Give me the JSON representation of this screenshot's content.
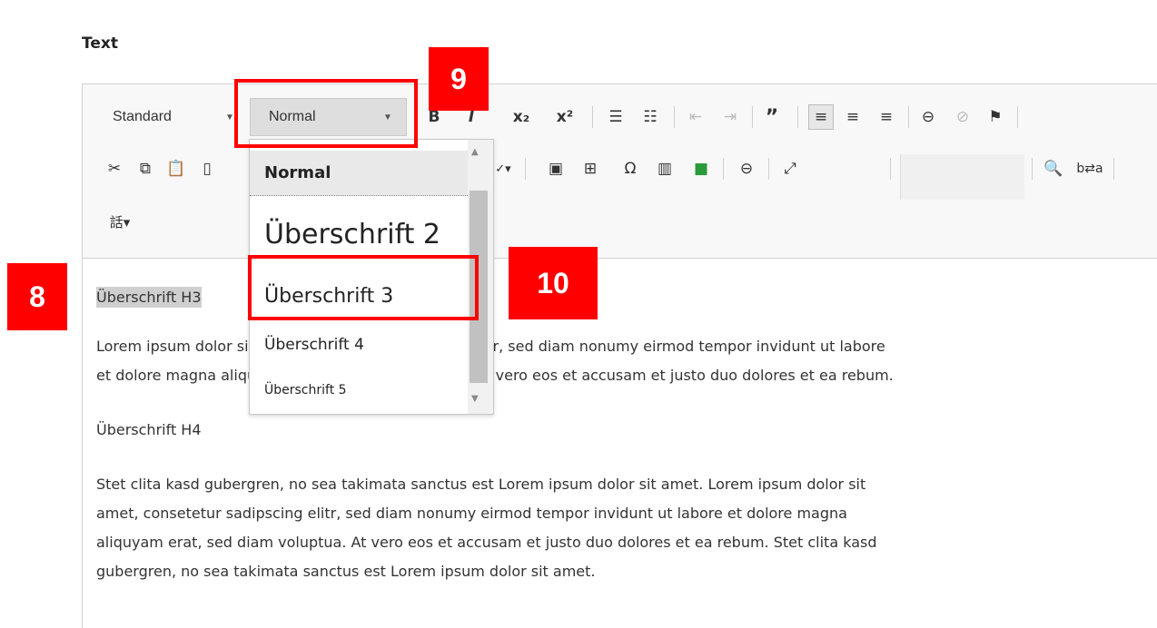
{
  "field_label": "Text",
  "toolbar": {
    "styles_combo": "Standard",
    "format_combo": "Normal",
    "row1_icons": [
      "bold-icon",
      "italic-icon",
      "subscript-icon",
      "superscript-icon",
      "numbered-list-icon",
      "bulleted-list-icon",
      "outdent-icon",
      "indent-icon",
      "blockquote-icon",
      "align-left-icon",
      "align-center-icon",
      "align-right-icon",
      "link-icon",
      "unlink-icon",
      "anchor-icon"
    ],
    "row2_icons": [
      "cut-icon",
      "copy-icon",
      "paste-icon",
      "paste-text-icon",
      "spellcheck-icon",
      "image-icon",
      "table-icon",
      "special-char-icon",
      "template-icon",
      "flash-icon",
      "horizontal-rule-icon",
      "maximize-icon",
      "find-icon",
      "replace-icon"
    ],
    "row3_icons": [
      "language-icon"
    ]
  },
  "dropdown": {
    "items": [
      "Normal",
      "Überschrift 2",
      "Überschrift 3",
      "Überschrift 4",
      "Überschrift 5"
    ],
    "selected": "Normal"
  },
  "content": {
    "heading_h3": "Überschrift H3",
    "para1_line1": "Lorem ipsum dolor sit amet, consetetur sadipscing elitr, sed diam nonumy eirmod tempor invidunt ut labore",
    "para1_line2": "et dolore magna aliquyam erat, sed diam voluptua. At vero eos et accusam et justo duo dolores et ea rebum.",
    "heading_h4": "Überschrift H4",
    "para2_line1": "Stet clita kasd gubergren, no sea takimata sanctus est Lorem ipsum dolor sit amet. Lorem ipsum dolor sit",
    "para2_line2": "amet, consetetur sadipscing elitr, sed diam nonumy eirmod tempor invidunt ut labore et dolore magna",
    "para2_line3": "aliquyam erat, sed diam voluptua. At vero eos et accusam et justo duo dolores et ea rebum. Stet clita kasd",
    "para2_line4": "gubergren, no sea takimata sanctus est Lorem ipsum dolor sit amet."
  },
  "annotations": {
    "step8": "8",
    "step9": "9",
    "step10": "10",
    "color": "#ff0000"
  }
}
